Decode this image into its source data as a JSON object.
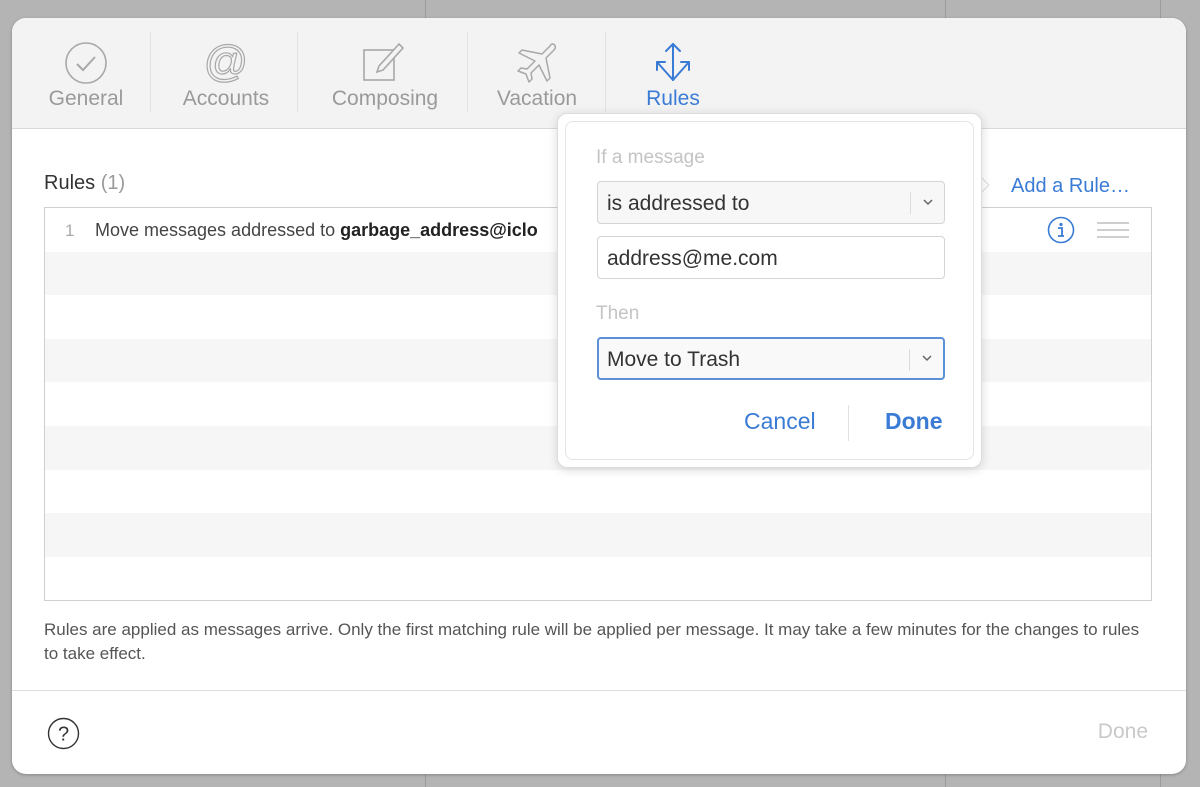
{
  "toolbar": {
    "tabs": [
      {
        "label": "General",
        "icon": "checkmark-circle-icon",
        "active": false
      },
      {
        "label": "Accounts",
        "icon": "at-sign-icon",
        "active": false
      },
      {
        "label": "Composing",
        "icon": "compose-icon",
        "active": false
      },
      {
        "label": "Vacation",
        "icon": "airplane-icon",
        "active": false
      },
      {
        "label": "Rules",
        "icon": "rules-arrows-icon",
        "active": true
      }
    ]
  },
  "rules": {
    "heading": "Rules",
    "count": "(1)",
    "add_rule_label": "Add a Rule…",
    "items": [
      {
        "number": "1",
        "text_prefix": "Move messages addressed to ",
        "text_bold": "garbage_address@iclo"
      }
    ],
    "footnote": "Rules are applied as messages arrive. Only the first matching rule will be applied per message. It may take a few minutes for the changes to rules to take effect."
  },
  "popover": {
    "if_label": "If a message",
    "condition_select": "is addressed to",
    "condition_value": "address@me.com",
    "then_label": "Then",
    "action_select": "Move to Trash",
    "cancel_label": "Cancel",
    "done_label": "Done"
  },
  "footer": {
    "done_label": "Done",
    "help_icon": "question-circle-icon"
  },
  "colors": {
    "accent": "#3a7bd5",
    "inactive_tab": "#9a9a9a",
    "disabled_done": "#c9c9c9"
  }
}
